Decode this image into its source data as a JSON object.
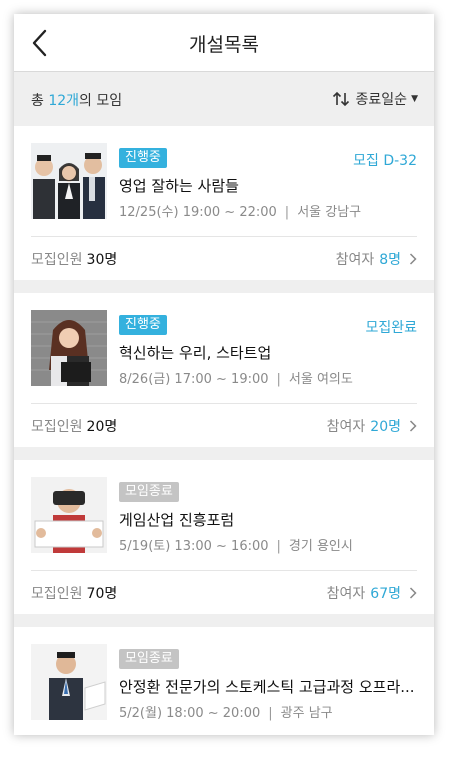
{
  "header": {
    "title": "개설목록"
  },
  "summary": {
    "prefix": "총 ",
    "count": "12개",
    "suffix": "의 모임",
    "sort_label": "종료일순"
  },
  "colors": {
    "accent": "#2fa8d6",
    "ended_badge": "#c4c4c4"
  },
  "icons": {
    "back": "chevron-left-icon",
    "sort": "sort-arrows-icon",
    "more": "chevron-right-icon"
  },
  "meetings": [
    {
      "badge": "진행중",
      "badge_state": "active",
      "status_right": "모집 D-32",
      "title": "영업 잘하는 사람들",
      "datetime": "12/25(수) 19:00 ~ 22:00",
      "location": "서울 강남구",
      "recruit_label": "모집인원",
      "recruit_count": "30명",
      "participants_label": "참여자",
      "participants_count": "8명",
      "image": "three-business-people"
    },
    {
      "badge": "진행중",
      "badge_state": "active",
      "status_right": "모집완료",
      "title": "혁신하는 우리, 스타트업",
      "datetime": "8/26(금) 17:00 ~ 19:00",
      "location": "서울 여의도",
      "recruit_label": "모집인원",
      "recruit_count": "20명",
      "participants_label": "참여자",
      "participants_count": "20명",
      "image": "woman-with-folder"
    },
    {
      "badge": "모임종료",
      "badge_state": "ended",
      "status_right": "",
      "title": "게임산업 진흥포럼",
      "datetime": "5/19(토) 13:00 ~ 16:00",
      "location": "경기 용인시",
      "recruit_label": "모집인원",
      "recruit_count": "70명",
      "participants_label": "참여자",
      "participants_count": "67명",
      "image": "man-with-vr-headset"
    },
    {
      "badge": "모임종료",
      "badge_state": "ended",
      "status_right": "",
      "title": "안정환 전문가의 스토케스틱 고급과정 오프라...",
      "datetime": "5/2(월) 18:00 ~ 20:00",
      "location": "광주 남구",
      "recruit_label": "",
      "recruit_count": "",
      "participants_label": "",
      "participants_count": "",
      "image": "businessman-presenting"
    }
  ]
}
